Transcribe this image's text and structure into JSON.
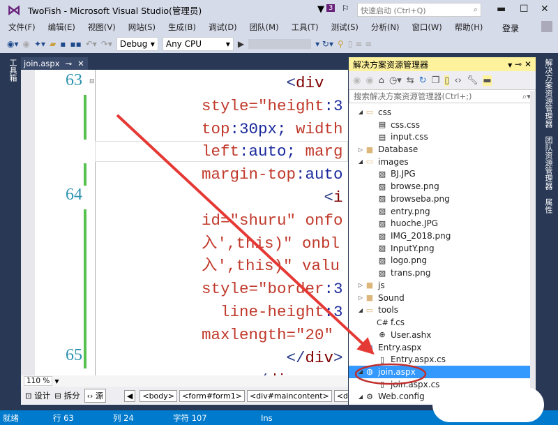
{
  "title": "TwoFish - Microsoft Visual Studio(管理员)",
  "notif_count": "3",
  "quick_launch_placeholder": "快速启动 (Ctrl+Q)",
  "menu": [
    "文件(F)",
    "编辑(E)",
    "视图(V)",
    "网站(S)",
    "生成(B)",
    "调试(D)",
    "团队(M)",
    "工具(T)",
    "测试(S)",
    "分析(N)",
    "窗口(W)",
    "帮助(H)"
  ],
  "login": "登录",
  "toolbar": {
    "config": "Debug",
    "platform": "Any CPU"
  },
  "left_tab": "工具箱",
  "doc_tab": "join.aspx",
  "editor": {
    "line_numbers": [
      {
        "n": "63",
        "row": 0
      },
      {
        "n": "64",
        "row": 5
      },
      {
        "n": "65",
        "row": 12
      }
    ],
    "lines": [
      [
        [
          "         <",
          "b"
        ],
        [
          "div",
          "t"
        ]
      ],
      [
        [
          "style=\"",
          "p"
        ],
        [
          "height",
          "p"
        ],
        [
          ":3",
          "v"
        ]
      ],
      [
        [
          "top",
          "p"
        ],
        [
          ":30px; ",
          "v"
        ],
        [
          "width",
          "p"
        ]
      ],
      [
        [
          "left",
          "p"
        ],
        [
          ":auto; ",
          "v"
        ],
        [
          "marg",
          "p"
        ]
      ],
      [
        [
          "margin-top",
          "p"
        ],
        [
          ":auto",
          "v"
        ]
      ],
      [
        [
          "             <",
          "b"
        ],
        [
          "i",
          "t"
        ]
      ],
      [
        [
          "id=\"shuru\" onfo",
          "p"
        ]
      ],
      [
        [
          "入',this)\" onbl",
          "p"
        ]
      ],
      [
        [
          "入',this)\" valu",
          "p"
        ]
      ],
      [
        [
          "style=\"border",
          "p"
        ],
        [
          ":3",
          "v"
        ]
      ],
      [
        [
          "  line-height",
          "p"
        ],
        [
          ":3",
          "v"
        ]
      ],
      [
        [
          "maxlength=\"20\"",
          "p"
        ]
      ],
      [
        [
          "         </",
          "b"
        ],
        [
          "div",
          "t"
        ],
        [
          ">",
          "b"
        ]
      ],
      [
        [
          "     </",
          "b"
        ],
        [
          "div",
          "t"
        ],
        [
          ">",
          "b"
        ]
      ]
    ],
    "zoom": "110 %"
  },
  "view_buttons": {
    "design": "设计",
    "split": "拆分",
    "source": "源"
  },
  "breadcrumb": [
    "<body>",
    "<form#form1>",
    "<div#maincontent>",
    "<d"
  ],
  "solution_explorer": {
    "title": "解决方案资源管理器",
    "search_placeholder": "搜索解决方案资源管理器(Ctrl+;)",
    "items": [
      {
        "label": "css",
        "indent": 1,
        "exp": "open",
        "icon": "folder-open"
      },
      {
        "label": "css.css",
        "indent": 2,
        "icon": "css-file"
      },
      {
        "label": "input.css",
        "indent": 2,
        "icon": "css-file"
      },
      {
        "label": "Database",
        "indent": 1,
        "exp": "closed",
        "icon": "folder"
      },
      {
        "label": "images",
        "indent": 1,
        "exp": "open",
        "icon": "folder-open"
      },
      {
        "label": "BJ.JPG",
        "indent": 2,
        "icon": "image-file"
      },
      {
        "label": "browse.png",
        "indent": 2,
        "icon": "image-file"
      },
      {
        "label": "browseba.png",
        "indent": 2,
        "icon": "image-file"
      },
      {
        "label": "entry.png",
        "indent": 2,
        "icon": "image-file"
      },
      {
        "label": "huoche.JPG",
        "indent": 2,
        "icon": "image-file"
      },
      {
        "label": "IMG_2018.png",
        "indent": 2,
        "icon": "image-file"
      },
      {
        "label": "InputY.png",
        "indent": 2,
        "icon": "image-file"
      },
      {
        "label": "logo.png",
        "indent": 2,
        "icon": "image-file"
      },
      {
        "label": "trans.png",
        "indent": 2,
        "icon": "image-file"
      },
      {
        "label": "js",
        "indent": 1,
        "exp": "closed",
        "icon": "folder"
      },
      {
        "label": "Sound",
        "indent": 1,
        "exp": "closed",
        "icon": "folder"
      },
      {
        "label": "tools",
        "indent": 1,
        "exp": "open",
        "icon": "folder-open"
      },
      {
        "label": "f.cs",
        "indent": 2,
        "icon": "csharp-file"
      },
      {
        "label": "User.ashx",
        "indent": 2,
        "icon": "handler-file"
      },
      {
        "label": "Entry.aspx",
        "indent": 1,
        "icon": "aspx-file"
      },
      {
        "label": "Entry.aspx.cs",
        "indent": 2,
        "icon": "cs-file"
      },
      {
        "label": "join.aspx",
        "indent": 1,
        "exp": "open",
        "icon": "aspx-file",
        "selected": true
      },
      {
        "label": "join.aspx.cs",
        "indent": 2,
        "icon": "cs-file"
      },
      {
        "label": "Web.config",
        "indent": 1,
        "exp": "open",
        "icon": "config-file"
      }
    ]
  },
  "right_tabs": [
    "解决方案资源管理器",
    "团队资源管理器",
    "属性"
  ],
  "status": {
    "ready": "就绪",
    "row": "行 63",
    "col": "列 24",
    "char": "字符 107",
    "mode": "Ins"
  },
  "colors": {
    "accent": "#007acc",
    "selection": "#3399ff",
    "annotation": "#e53935"
  }
}
